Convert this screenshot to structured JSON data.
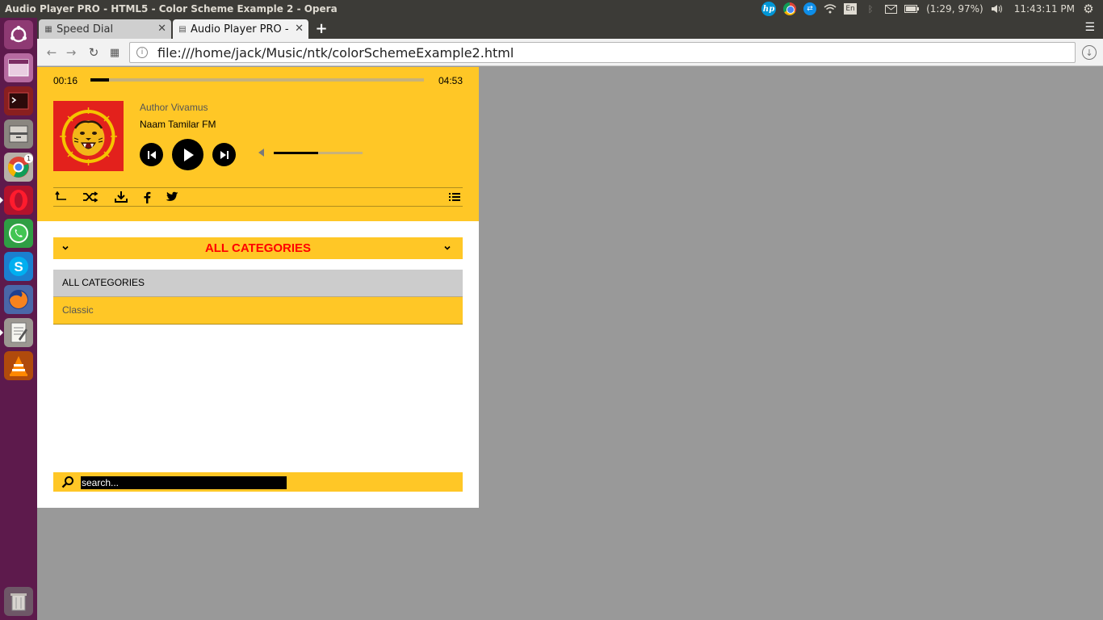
{
  "system_panel": {
    "window_title": "Audio Player PRO - HTML5 - Color Scheme Example 2 - Opera",
    "keyboard_layout": "En",
    "battery": "(1:29, 97%)",
    "clock": "11:43:11 PM",
    "tray_icons": [
      "hp-icon",
      "chrome-icon",
      "teamviewer-icon",
      "wifi-icon",
      "keyboard-icon",
      "bluetooth-icon",
      "mail-icon",
      "battery-icon",
      "volume-icon",
      "settings-gear-icon"
    ]
  },
  "launcher": {
    "items": [
      "ubuntu-dash",
      "workspace-switcher",
      "terminal",
      "files",
      "chrome",
      "opera",
      "whatsapp",
      "skype",
      "firefox",
      "text-editor",
      "vlc",
      "trash"
    ],
    "chrome_badge": "1"
  },
  "browser": {
    "tabs": [
      {
        "label": "Speed Dial",
        "active": false
      },
      {
        "label": "Audio Player PRO - H",
        "active": true
      }
    ],
    "url": "file:///home/jack/Music/ntk/colorSchemeExample2.html"
  },
  "player": {
    "time_current": "00:16",
    "time_total": "04:53",
    "progress": 0.055,
    "volume": 0.5,
    "track": {
      "author": "Author Vivamus",
      "title": "Naam Tamilar FM"
    },
    "colors": {
      "accent": "#ffc726",
      "category_label": "#ff0000",
      "selected_row": "#cccccc",
      "panel_background": "#ffffff"
    },
    "category_select_label": "ALL CATEGORIES",
    "categories": [
      {
        "label": "ALL CATEGORIES",
        "selected": true
      },
      {
        "label": "Classic",
        "selected": false
      }
    ],
    "search_placeholder": "search..."
  }
}
